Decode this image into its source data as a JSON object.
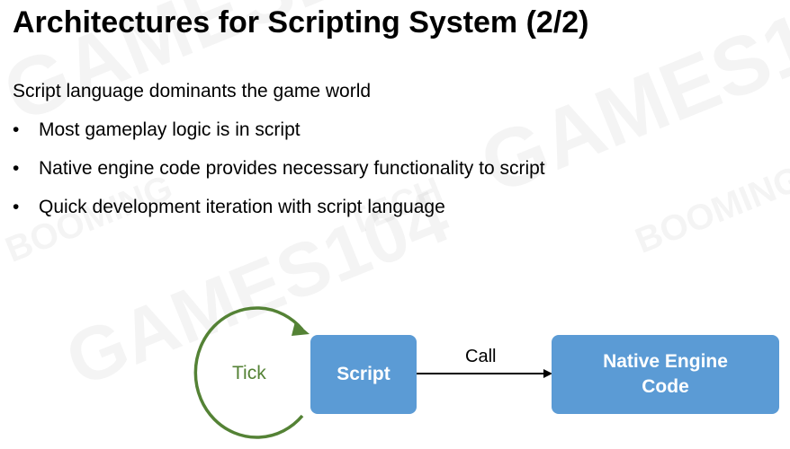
{
  "slide": {
    "title": "Architectures for Scripting System (2/2)",
    "intro": "Script language dominants the game world",
    "bullets": [
      "Most gameplay logic is in script",
      "Native engine code provides necessary functionality to script",
      "Quick development iteration with script language"
    ],
    "bullet_char": "•"
  },
  "diagram": {
    "tick_label": "Tick",
    "script_label": "Script",
    "call_label": "Call",
    "native_line1": "Native Engine",
    "native_line2": "Code"
  },
  "watermarks": {
    "main": "GAMES104",
    "brand_line1": "BOOMING",
    "brand_line2": "TECH"
  },
  "colors": {
    "box_fill": "#5b9bd5",
    "tick_color": "#548235",
    "arrow_color": "#000000"
  }
}
